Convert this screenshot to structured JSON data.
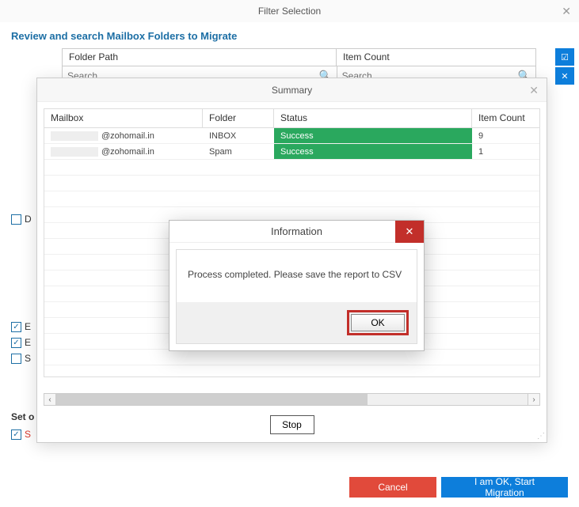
{
  "main": {
    "title": "Filter Selection",
    "header": "Review and search Mailbox Folders to Migrate",
    "columns": {
      "path": "Folder Path",
      "count": "Item Count"
    },
    "search_placeholder": "Search",
    "checkboxes": {
      "d": "D",
      "e1": "E",
      "e2": "E",
      "s": "S"
    },
    "set_label": "Set o",
    "set_s": "S",
    "cancel": "Cancel",
    "start": "I am OK, Start Migration"
  },
  "summary": {
    "title": "Summary",
    "columns": {
      "mailbox": "Mailbox",
      "folder": "Folder",
      "status": "Status",
      "count": "Item Count"
    },
    "rows": [
      {
        "mailbox_suffix": "@zohomail.in",
        "folder": "INBOX",
        "status": "Success",
        "count": "9"
      },
      {
        "mailbox_suffix": "@zohomail.in",
        "folder": "Spam",
        "status": "Success",
        "count": "1"
      }
    ],
    "stop": "Stop"
  },
  "info": {
    "title": "Information",
    "message": "Process completed. Please save the report to CSV",
    "ok": "OK"
  }
}
